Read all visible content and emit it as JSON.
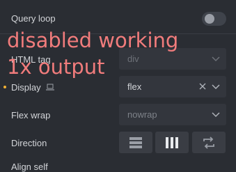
{
  "query_loop": {
    "label": "Query loop",
    "enabled": false
  },
  "overlay": {
    "line1": "disabled working",
    "line2": "1x output"
  },
  "fields": {
    "html_tag": {
      "label": "HTML tag",
      "value": "div"
    },
    "display": {
      "label": "Display",
      "value": "flex",
      "modified": true,
      "device_icon": "laptop-icon",
      "accent": "#f2b134"
    },
    "flex_wrap": {
      "label": "Flex wrap",
      "value": "nowrap"
    },
    "direction": {
      "label": "Direction",
      "options": [
        "rows-icon",
        "columns-icon",
        "reverse-icon"
      ]
    },
    "align_self": {
      "label": "Align self"
    }
  }
}
